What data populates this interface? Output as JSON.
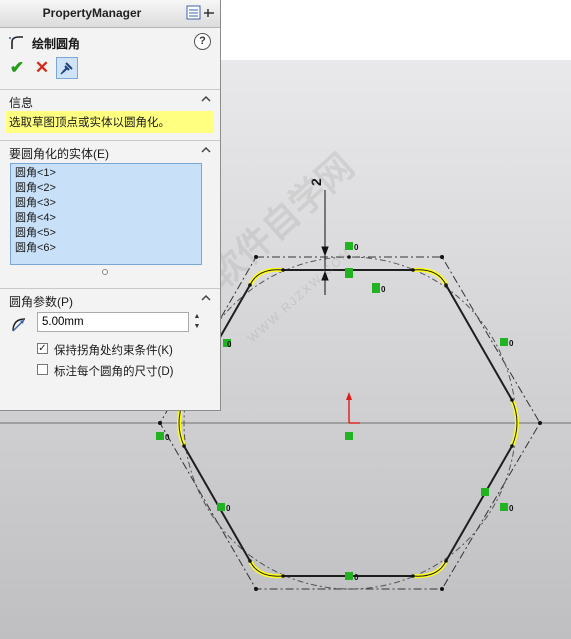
{
  "panel": {
    "title": "PropertyManager",
    "feature_name": "绘制圆角",
    "help_label": "?",
    "actions": {
      "ok": "✔",
      "cancel": "✕"
    }
  },
  "info_group": {
    "label": "信息",
    "message": "选取草图顶点或实体以圆角化。"
  },
  "entities_group": {
    "label": "要圆角化的实体(E)",
    "items": [
      "圆角<1>",
      "圆角<2>",
      "圆角<3>",
      "圆角<4>",
      "圆角<5>",
      "圆角<6>"
    ]
  },
  "params_group": {
    "label": "圆角参数(P)",
    "radius_value": "5.00mm",
    "keep_constraints": {
      "label": "保持拐角处约束条件(K)",
      "checked": true
    },
    "dimension_each": {
      "label": "标注每个圆角的尺寸(D)",
      "checked": false
    }
  },
  "sketch": {
    "dimension_label": "2",
    "relation_labels": [
      "0",
      "0",
      "0",
      "0",
      "0",
      "0",
      "0",
      "0"
    ],
    "colors": {
      "fillet": "#ffff1a",
      "relation": "#22b322",
      "origin": "#e21a1a"
    }
  },
  "watermark": {
    "main": "软件自学网",
    "url": "WWW.RJZXW.COM"
  }
}
